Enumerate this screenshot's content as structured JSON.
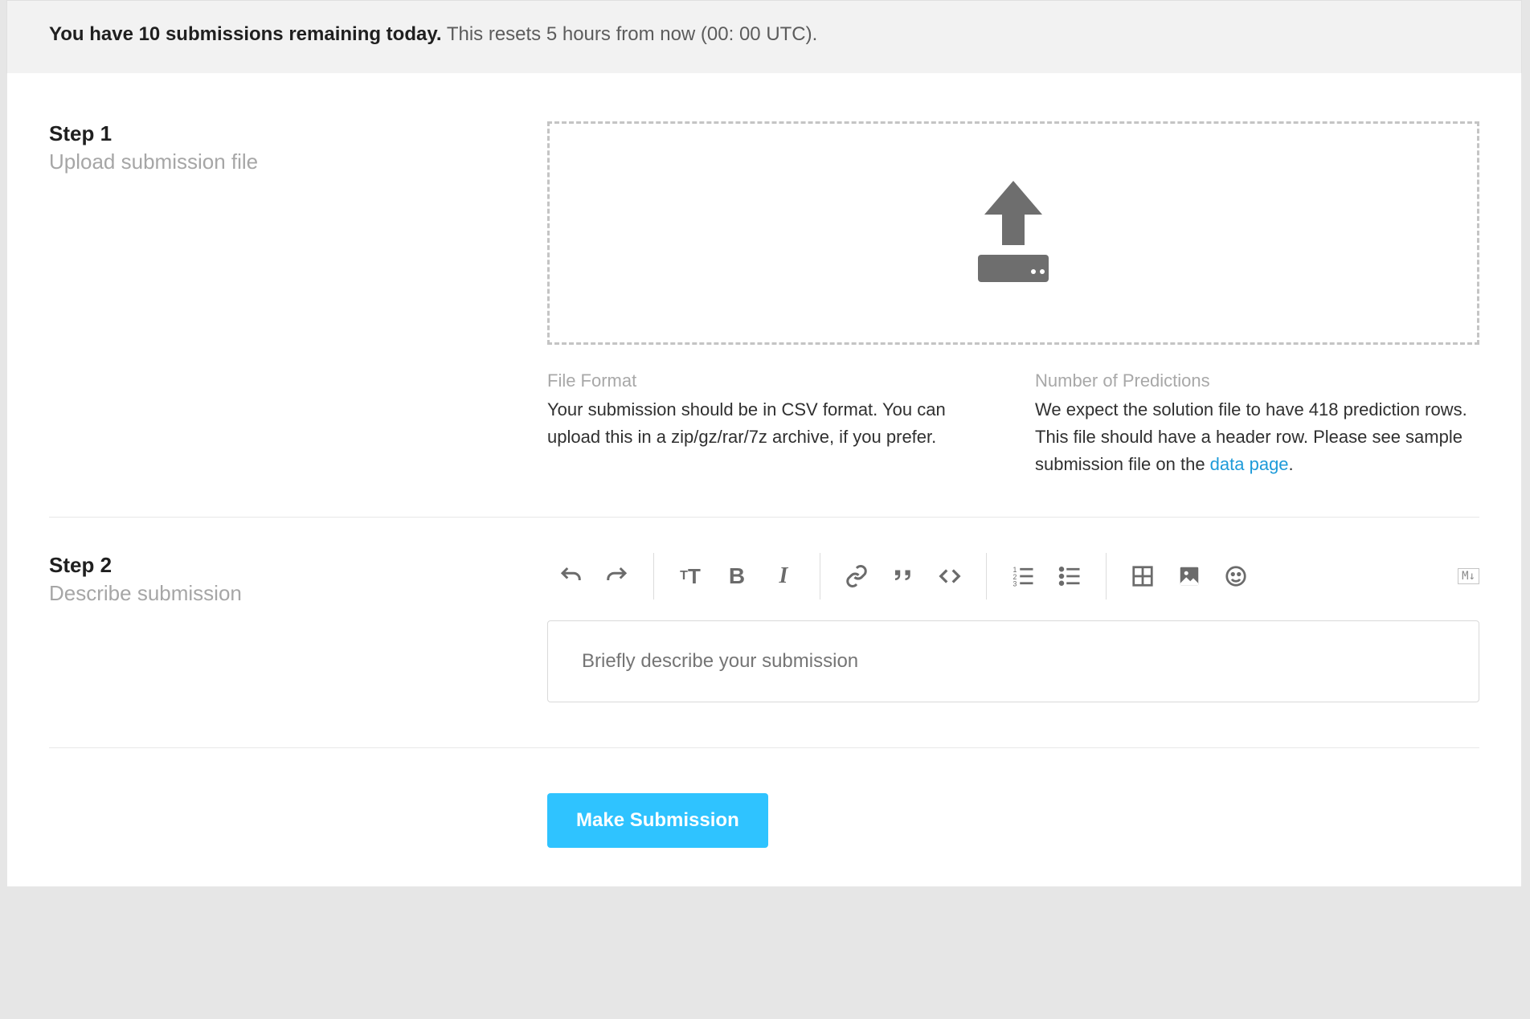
{
  "banner": {
    "bold": "You have 10 submissions remaining today.",
    "rest": " This resets 5 hours from now (00: 00 UTC)."
  },
  "step1": {
    "title": "Step 1",
    "sub": "Upload submission file",
    "fileformat": {
      "head": "File Format",
      "body": "Your submission should be in CSV format. You can upload this in a zip/gz/rar/7z archive, if you prefer."
    },
    "predictions": {
      "head": "Number of Predictions",
      "body_pre": "We expect the solution file to have 418 prediction rows. This file should have a header row. Please see sample submission file on the ",
      "link": "data page",
      "body_post": "."
    }
  },
  "step2": {
    "title": "Step 2",
    "sub": "Describe submission",
    "placeholder": "Briefly describe your submission",
    "toolbar": {
      "md": "M↓"
    }
  },
  "submit": {
    "label": "Make Submission"
  }
}
